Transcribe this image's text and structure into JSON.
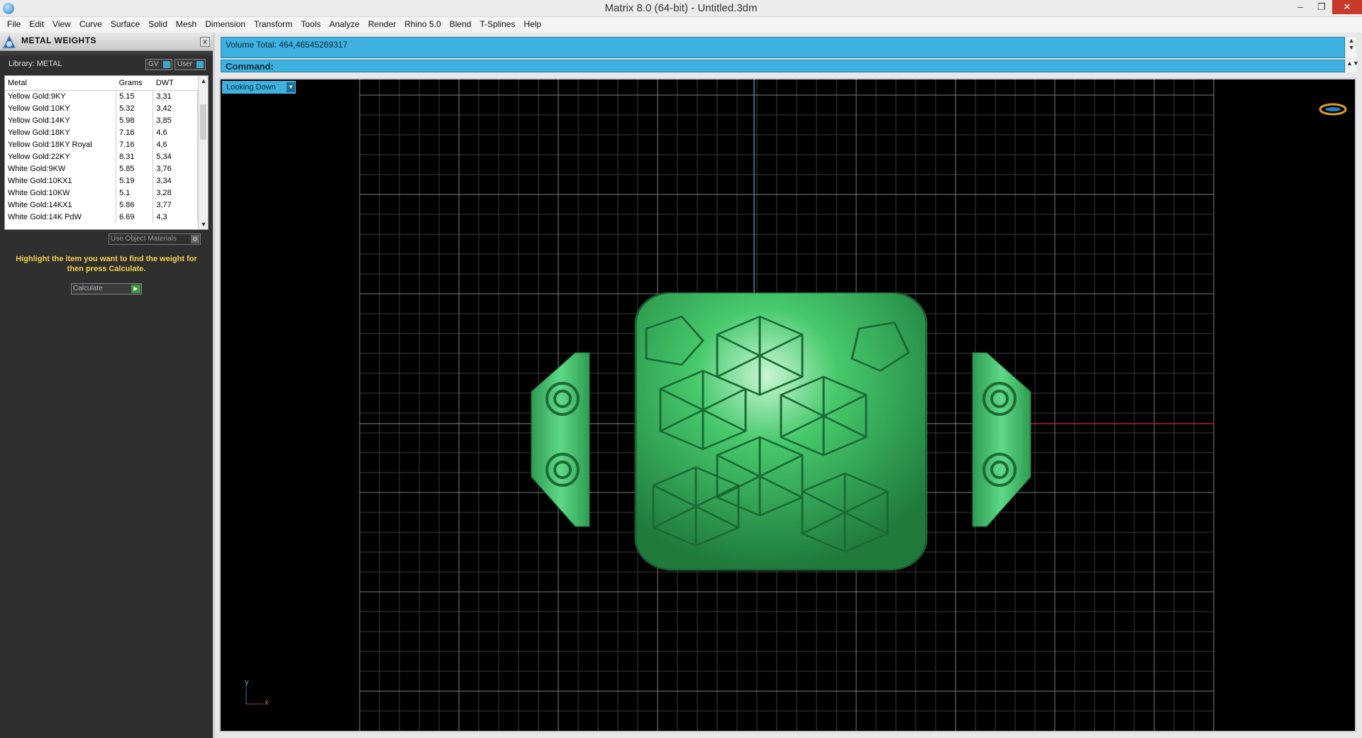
{
  "window": {
    "title": "Matrix 8.0 (64-bit) - Untitled.3dm",
    "min_label": "–",
    "max_label": "❐",
    "close_label": "✕"
  },
  "menu": [
    "File",
    "Edit",
    "View",
    "Curve",
    "Surface",
    "Solid",
    "Mesh",
    "Dimension",
    "Transform",
    "Tools",
    "Analyze",
    "Render",
    "Rhino 5.0",
    "Blend",
    "T-Splines",
    "Help"
  ],
  "panel": {
    "title": "METAL WEIGHTS",
    "close_label": "x",
    "library_label": "Library: METAL",
    "gv_label": "GV",
    "user_label": "User",
    "columns": [
      "Metal",
      "Grams",
      "DWT"
    ],
    "rows": [
      [
        "Yellow Gold:9KY",
        "5.15",
        "3,31"
      ],
      [
        "Yellow Gold:10KY",
        "5.32",
        "3,42"
      ],
      [
        "Yellow Gold:14KY",
        "5.98",
        "3,85"
      ],
      [
        "Yellow Gold:18KY",
        "7.16",
        "4,6"
      ],
      [
        "Yellow Gold:18KY Royal",
        "7.16",
        "4,6"
      ],
      [
        "Yellow Gold:22KY",
        "8.31",
        "5,34"
      ],
      [
        "White Gold:9KW",
        "5.85",
        "3,76"
      ],
      [
        "White Gold:10KX1",
        "5.19",
        "3,34"
      ],
      [
        "White Gold:10KW",
        "5.1",
        "3,28"
      ],
      [
        "White Gold:14KX1",
        "5.86",
        "3,77"
      ],
      [
        "White Gold:14K PdW",
        "6.69",
        "4,3"
      ]
    ],
    "use_materials_label": "Use Object Materials",
    "hint": "Highlight the item you want to find the weight for then press Calculate.",
    "calculate_label": "Calculate"
  },
  "command": {
    "volume_text": "Volume Total: 464,46545269317",
    "command_label": "Command:"
  },
  "viewport": {
    "view_name": "Looking Down",
    "axis_y": "y",
    "axis_x": "x",
    "ring_color": "#3fc46a"
  }
}
